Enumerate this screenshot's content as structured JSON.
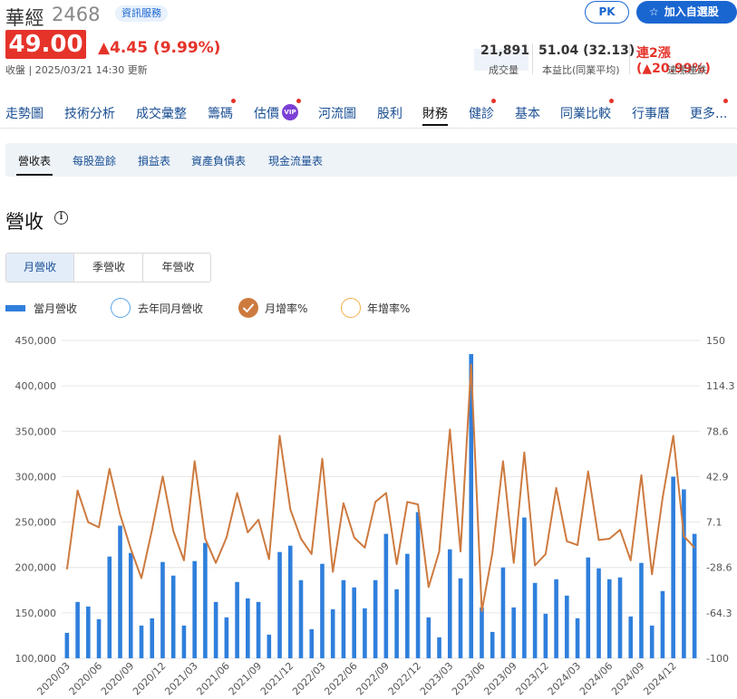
{
  "header": {
    "name": "華經",
    "code": "2468",
    "badge": "資訊服務",
    "pk_label": "PK",
    "watch_label": "加入自選股"
  },
  "quote": {
    "price": "49.00",
    "change": "▲4.45 (9.99%)",
    "meta": "收盤 | 2025/03/21 14:30 更新"
  },
  "stats": {
    "volume": "21,891",
    "volume_label": "成交量",
    "pe": "51.04 (32.13)",
    "pe_label": "本益比(同業平均)",
    "streak": "連2漲 (▲20.99%)",
    "streak_label": "連漲連跌"
  },
  "nav_tabs": [
    {
      "label": "走勢圖"
    },
    {
      "label": "技術分析"
    },
    {
      "label": "成交彙整"
    },
    {
      "label": "籌碼"
    },
    {
      "label": "估價"
    },
    {
      "label": "河流圖"
    },
    {
      "label": "股利"
    },
    {
      "label": "財務"
    },
    {
      "label": "健診"
    },
    {
      "label": "基本"
    },
    {
      "label": "同業比較"
    },
    {
      "label": "行事曆"
    },
    {
      "label": "更多..."
    }
  ],
  "vip_badge": "VIP",
  "sub_tabs": [
    {
      "label": "營收表"
    },
    {
      "label": "每股盈餘"
    },
    {
      "label": "損益表"
    },
    {
      "label": "資產負債表"
    },
    {
      "label": "現金流量表"
    }
  ],
  "section": {
    "title": "營收",
    "info_icon": "i"
  },
  "period_tabs": [
    {
      "label": "月營收"
    },
    {
      "label": "季營收"
    },
    {
      "label": "年營收"
    }
  ],
  "legend": {
    "bar": "當月營收",
    "last_year": "去年同月營收",
    "mom": "月增率%",
    "yoy": "年增率%"
  },
  "colors": {
    "accent": "#1a66d1",
    "up": "#e5332a",
    "bar": "#2f7fdc",
    "line": "#cd7a3f",
    "yoy_ring": "#f0b04a"
  },
  "chart_data": {
    "type": "bar",
    "left_axis": {
      "ticks": [
        "450,000",
        "400,000",
        "350,000",
        "300,000",
        "250,000",
        "200,000",
        "150,000",
        "100,000"
      ],
      "min": 100000,
      "max": 450000
    },
    "right_axis": {
      "ticks": [
        "150",
        "114.3",
        "78.6",
        "42.9",
        "7.1",
        "-28.6",
        "-64.3",
        "-100"
      ],
      "min": -100,
      "max": 150
    },
    "x_tick_labels": [
      "2020/03",
      "2020/06",
      "2020/09",
      "2020/12",
      "2021/03",
      "2021/06",
      "2021/09",
      "2021/12",
      "2022/03",
      "2022/06",
      "2022/09",
      "2022/12",
      "2023/03",
      "2023/06",
      "2023/09",
      "2023/12",
      "2024/03",
      "2024/06",
      "2024/09",
      "2024/12"
    ],
    "series": [
      {
        "name": "當月營收",
        "type": "bar",
        "values": [
          128000,
          162000,
          157000,
          143000,
          212000,
          246000,
          216000,
          136000,
          144000,
          206000,
          191000,
          136000,
          207000,
          227000,
          162000,
          145000,
          184000,
          166000,
          162000,
          126000,
          217000,
          224000,
          186000,
          132000,
          204000,
          154000,
          186000,
          178000,
          155000,
          186000,
          237000,
          176000,
          215000,
          261000,
          145000,
          123000,
          220000,
          188000,
          435000,
          156000,
          129000,
          200000,
          156000,
          255000,
          183000,
          149000,
          187000,
          169000,
          144000,
          211000,
          199000,
          187000,
          189000,
          146000,
          205000,
          136000,
          174000,
          300000,
          286000,
          237000
        ]
      },
      {
        "name": "月增率%",
        "type": "line",
        "values": [
          -30,
          32,
          7,
          3,
          49,
          13,
          -14,
          -37,
          1,
          43,
          0,
          -23,
          55,
          -6,
          -25,
          -5,
          30,
          -1,
          9,
          -22,
          75,
          17,
          -6,
          -18,
          57,
          -32,
          22,
          -5,
          -13,
          23,
          30,
          -26,
          23,
          21,
          -44,
          -16,
          80,
          -16,
          131,
          -63,
          -17,
          55,
          -25,
          62,
          -27,
          -18,
          34,
          -8,
          -11,
          47,
          -7,
          -6,
          1,
          -23,
          44,
          -34,
          26,
          75,
          -4,
          -13
        ]
      }
    ]
  }
}
